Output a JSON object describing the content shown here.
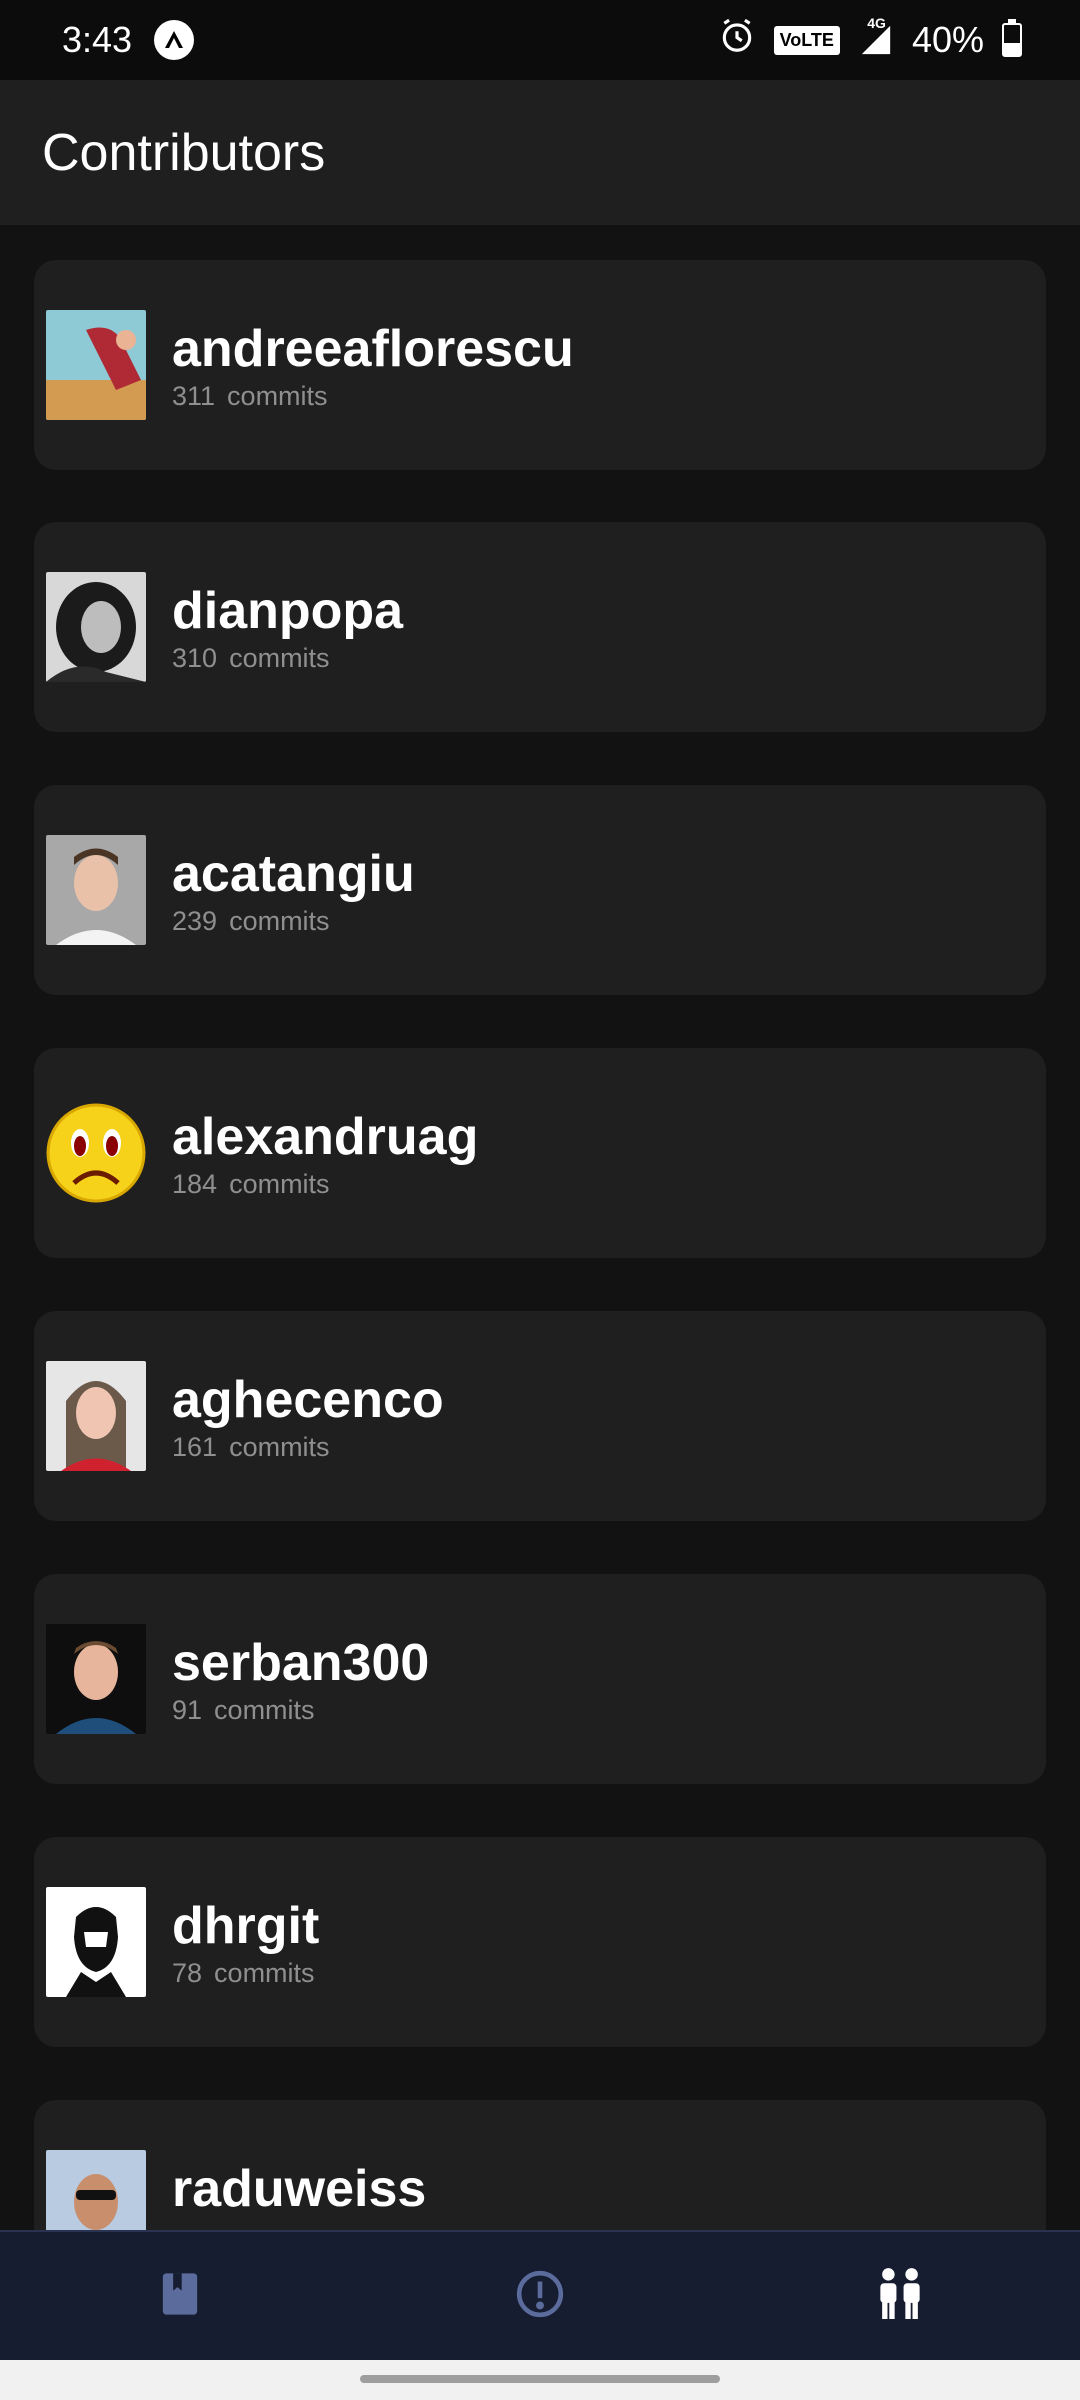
{
  "status_bar": {
    "time": "3:43",
    "volte": "VoLTE",
    "network": "4G",
    "battery": "40%",
    "battery_level": 0.4
  },
  "app_bar": {
    "title": "Contributors"
  },
  "contributors": [
    {
      "username": "andreeaflorescu",
      "commits": "311",
      "commits_label": "commits"
    },
    {
      "username": "dianpopa",
      "commits": "310",
      "commits_label": "commits"
    },
    {
      "username": "acatangiu",
      "commits": "239",
      "commits_label": "commits"
    },
    {
      "username": "alexandruag",
      "commits": "184",
      "commits_label": "commits"
    },
    {
      "username": "aghecenco",
      "commits": "161",
      "commits_label": "commits"
    },
    {
      "username": "serban300",
      "commits": "91",
      "commits_label": "commits"
    },
    {
      "username": "dhrgit",
      "commits": "78",
      "commits_label": "commits"
    },
    {
      "username": "raduweiss",
      "commits": "",
      "commits_label": ""
    }
  ],
  "bottom_nav": {
    "items": [
      {
        "icon": "book-icon",
        "active": false
      },
      {
        "icon": "issues-icon",
        "active": false
      },
      {
        "icon": "contributors-icon",
        "active": true
      }
    ]
  },
  "colors": {
    "background": "#121212",
    "card": "#1f1f1f",
    "nav_background": "#161d31",
    "inactive_icon": "#5a6b9c",
    "active_icon": "#ffffff"
  }
}
